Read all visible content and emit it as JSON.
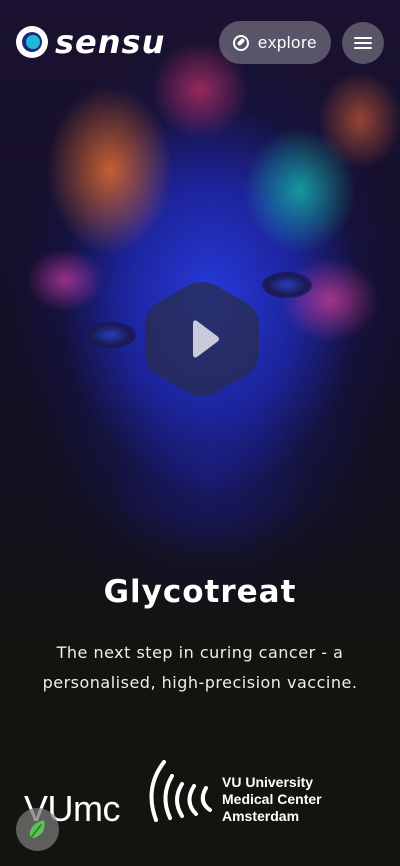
{
  "header": {
    "brand": "sensu",
    "explore_label": "explore",
    "menu_icon": "hamburger-icon",
    "compass_icon": "compass-icon"
  },
  "hero": {
    "play_icon": "play-icon",
    "title": "Glycotreat",
    "subtitle_line1": "The next step in curing cancer - a",
    "subtitle_line2": "personalised, high-precision vaccine."
  },
  "partner": {
    "logo_letters": "VUmc",
    "name_line1": "VU University",
    "name_line2": "Medical Center",
    "name_line3": "Amsterdam"
  },
  "fab": {
    "icon": "leaf-icon",
    "color": "#4caf50"
  },
  "colors": {
    "background": "#15130f",
    "brand_accent": "#22b9d9",
    "brand_dark": "#1b2a7a"
  }
}
